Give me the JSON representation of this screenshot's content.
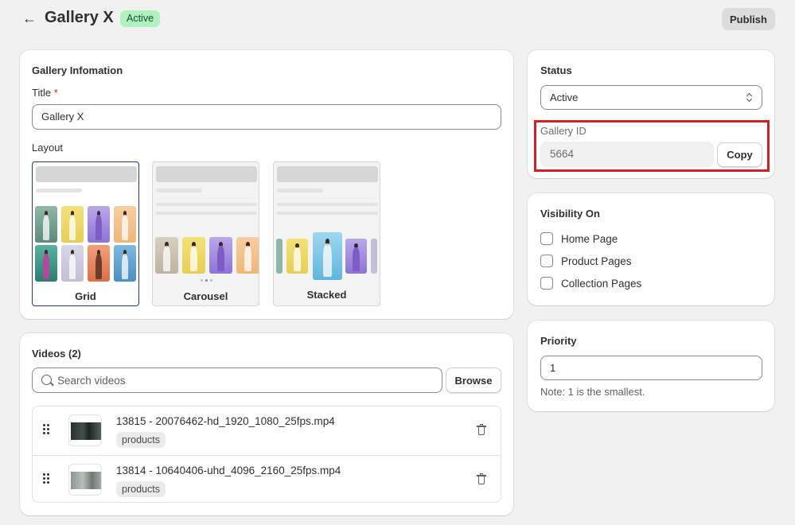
{
  "header": {
    "back_icon": "arrow-left-icon",
    "title": "Gallery X",
    "status_badge": "Active",
    "publish_label": "Publish"
  },
  "gallery_info": {
    "heading": "Gallery Infomation",
    "title_label": "Title",
    "required_mark": "*",
    "title_value": "Gallery X",
    "layout_label": "Layout",
    "layouts": [
      {
        "label": "Grid",
        "selected": true
      },
      {
        "label": "Carousel",
        "selected": false
      },
      {
        "label": "Stacked",
        "selected": false
      }
    ]
  },
  "videos": {
    "heading": "Videos (2)",
    "search_placeholder": "Search videos",
    "browse_label": "Browse",
    "items": [
      {
        "name": "13815 - 20076462-hd_1920_1080_25fps.mp4",
        "tag": "products"
      },
      {
        "name": "13814 - 10640406-uhd_4096_2160_25fps.mp4",
        "tag": "products"
      }
    ]
  },
  "status": {
    "heading": "Status",
    "selected": "Active",
    "gallery_id_label": "Gallery ID",
    "gallery_id_value": "5664",
    "copy_label": "Copy"
  },
  "visibility": {
    "heading": "Visibility On",
    "options": [
      {
        "label": "Home Page",
        "checked": false
      },
      {
        "label": "Product Pages",
        "checked": false
      },
      {
        "label": "Collection Pages",
        "checked": false
      }
    ]
  },
  "priority": {
    "heading": "Priority",
    "value": "1",
    "note": "Note: 1 is the smallest."
  },
  "colors": {
    "badge_bg": "#aff2bd",
    "badge_text": "#0c5132",
    "selected_layout_border": "#1f3b94",
    "highlight": "#d42020"
  }
}
